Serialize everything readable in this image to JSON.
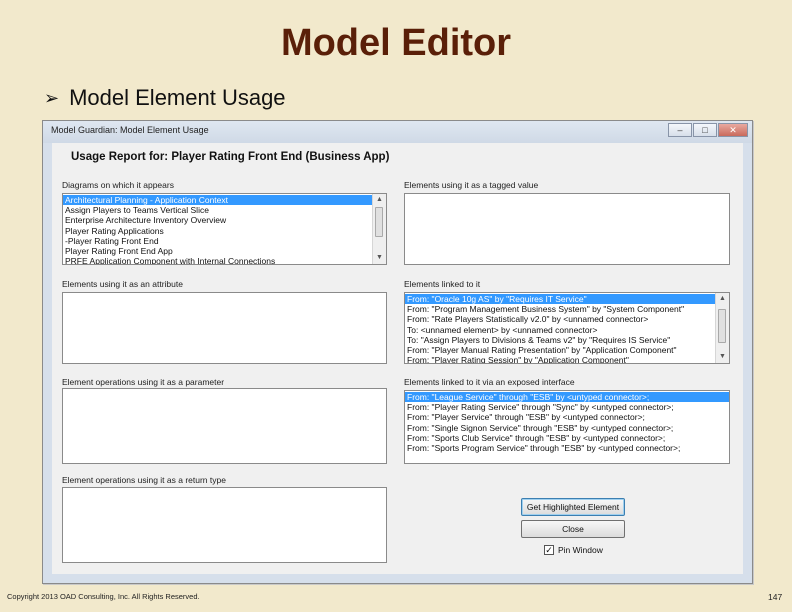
{
  "slide": {
    "title": "Model Editor",
    "bullet_icon": "arrowhead-bullet-icon",
    "bullet_glyph": "➢",
    "bullet": "Model Element Usage",
    "footer": "Copyright 2013 OAD Consulting, Inc. All Rights Reserved.",
    "page_number": "147"
  },
  "window": {
    "title": "Model Guardian: Model Element Usage",
    "controls": {
      "minimize": "–",
      "maximize": "□",
      "close": "✕"
    },
    "report_header": "Usage Report for: Player Rating Front End (Business App)",
    "diagrams": {
      "label": "Diagrams on which it appears",
      "items": [
        "Architectural Planning - Application Context",
        "Assign Players to Teams Vertical Slice",
        "Enterprise Architecture Inventory Overview",
        "Player Rating Applications",
        "-Player Rating Front End",
        "Player Rating Front End App",
        "PRFE Application Component with Internal Connections"
      ],
      "selected_index": 0
    },
    "tagged_value": {
      "label": "Elements using it as a tagged value",
      "items": []
    },
    "attribute": {
      "label": "Elements using it as an attribute",
      "items": []
    },
    "linked": {
      "label": "Elements linked to it",
      "items": [
        "From:  \"Oracle 10g AS\" by \"Requires IT Service\"",
        "From:  \"Program Management Business System\" by \"System Component\"",
        "From:  \"Rate Players Statistically v2.0\" by <unnamed connector>",
        "To:     <unnamed element> by <unnamed connector>",
        "To:     \"Assign Players to Divisions & Teams v2\" by \"Requires IS Service\"",
        "From:  \"Player Manual Rating Presentation\" by \"Application Component\"",
        "From:  \"Player Rating Session\" by \"Application Component\""
      ],
      "selected_index": 0
    },
    "parameter": {
      "label": "Element operations using it as a parameter",
      "items": []
    },
    "interface": {
      "label": "Elements linked to it via an exposed interface",
      "items": [
        "From:  \"League Service\" through \"ESB\" by <untyped connector>;",
        "From:  \"Player Rating Service\" through \"Sync\" by <untyped connector>;",
        "From:  \"Player Service\" through \"ESB\" by <untyped connector>;",
        "From:  \"Single Signon Service\" through \"ESB\" by <untyped connector>;",
        "From:  \"Sports Club Service\" through \"ESB\" by <untyped connector>;",
        "From:  \"Sports Program Service\" through \"ESB\" by <untyped connector>;"
      ],
      "selected_index": 0
    },
    "return_type": {
      "label": "Element operations using it as a return type",
      "items": []
    },
    "buttons": {
      "get_highlighted": "Get Highlighted Element",
      "close": "Close"
    },
    "pin_window": {
      "label": "Pin Window",
      "checked": true,
      "check_glyph": "✓"
    }
  }
}
